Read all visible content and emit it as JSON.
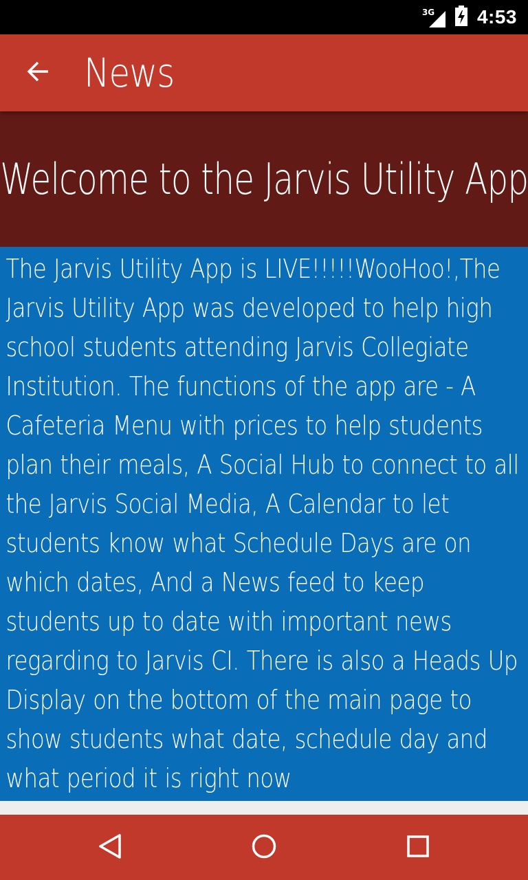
{
  "status_bar": {
    "network": "3G",
    "time": "4:53",
    "icons": [
      "signal-icon",
      "battery-charging-icon"
    ]
  },
  "app_bar": {
    "title": "News",
    "back_icon": "arrow-left-icon",
    "color": "#c0392b"
  },
  "banner": {
    "text": "Welcome to the Jarvis Utility App",
    "color": "#611a15"
  },
  "news": {
    "body": "The Jarvis Utility App is LIVE!!!!!WooHoo!,The Jarvis Utility App was developed to help high school students attending Jarvis Collegiate Institution. The functions of the app are - A Cafeteria Menu with prices to help students plan their meals,  A Social Hub to connect to all the Jarvis Social Media, A Calendar to let students know what Schedule Days are on which dates, And a News feed to keep students up to date with important news regarding to Jarvis CI. There is also a Heads Up Display on the bottom of the main page to show students what date, schedule day and what period it is right now",
    "color": "#0a6db8"
  },
  "nav_bar": {
    "icons": [
      "nav-back-icon",
      "nav-home-icon",
      "nav-recents-icon"
    ],
    "color": "#c0392b"
  }
}
